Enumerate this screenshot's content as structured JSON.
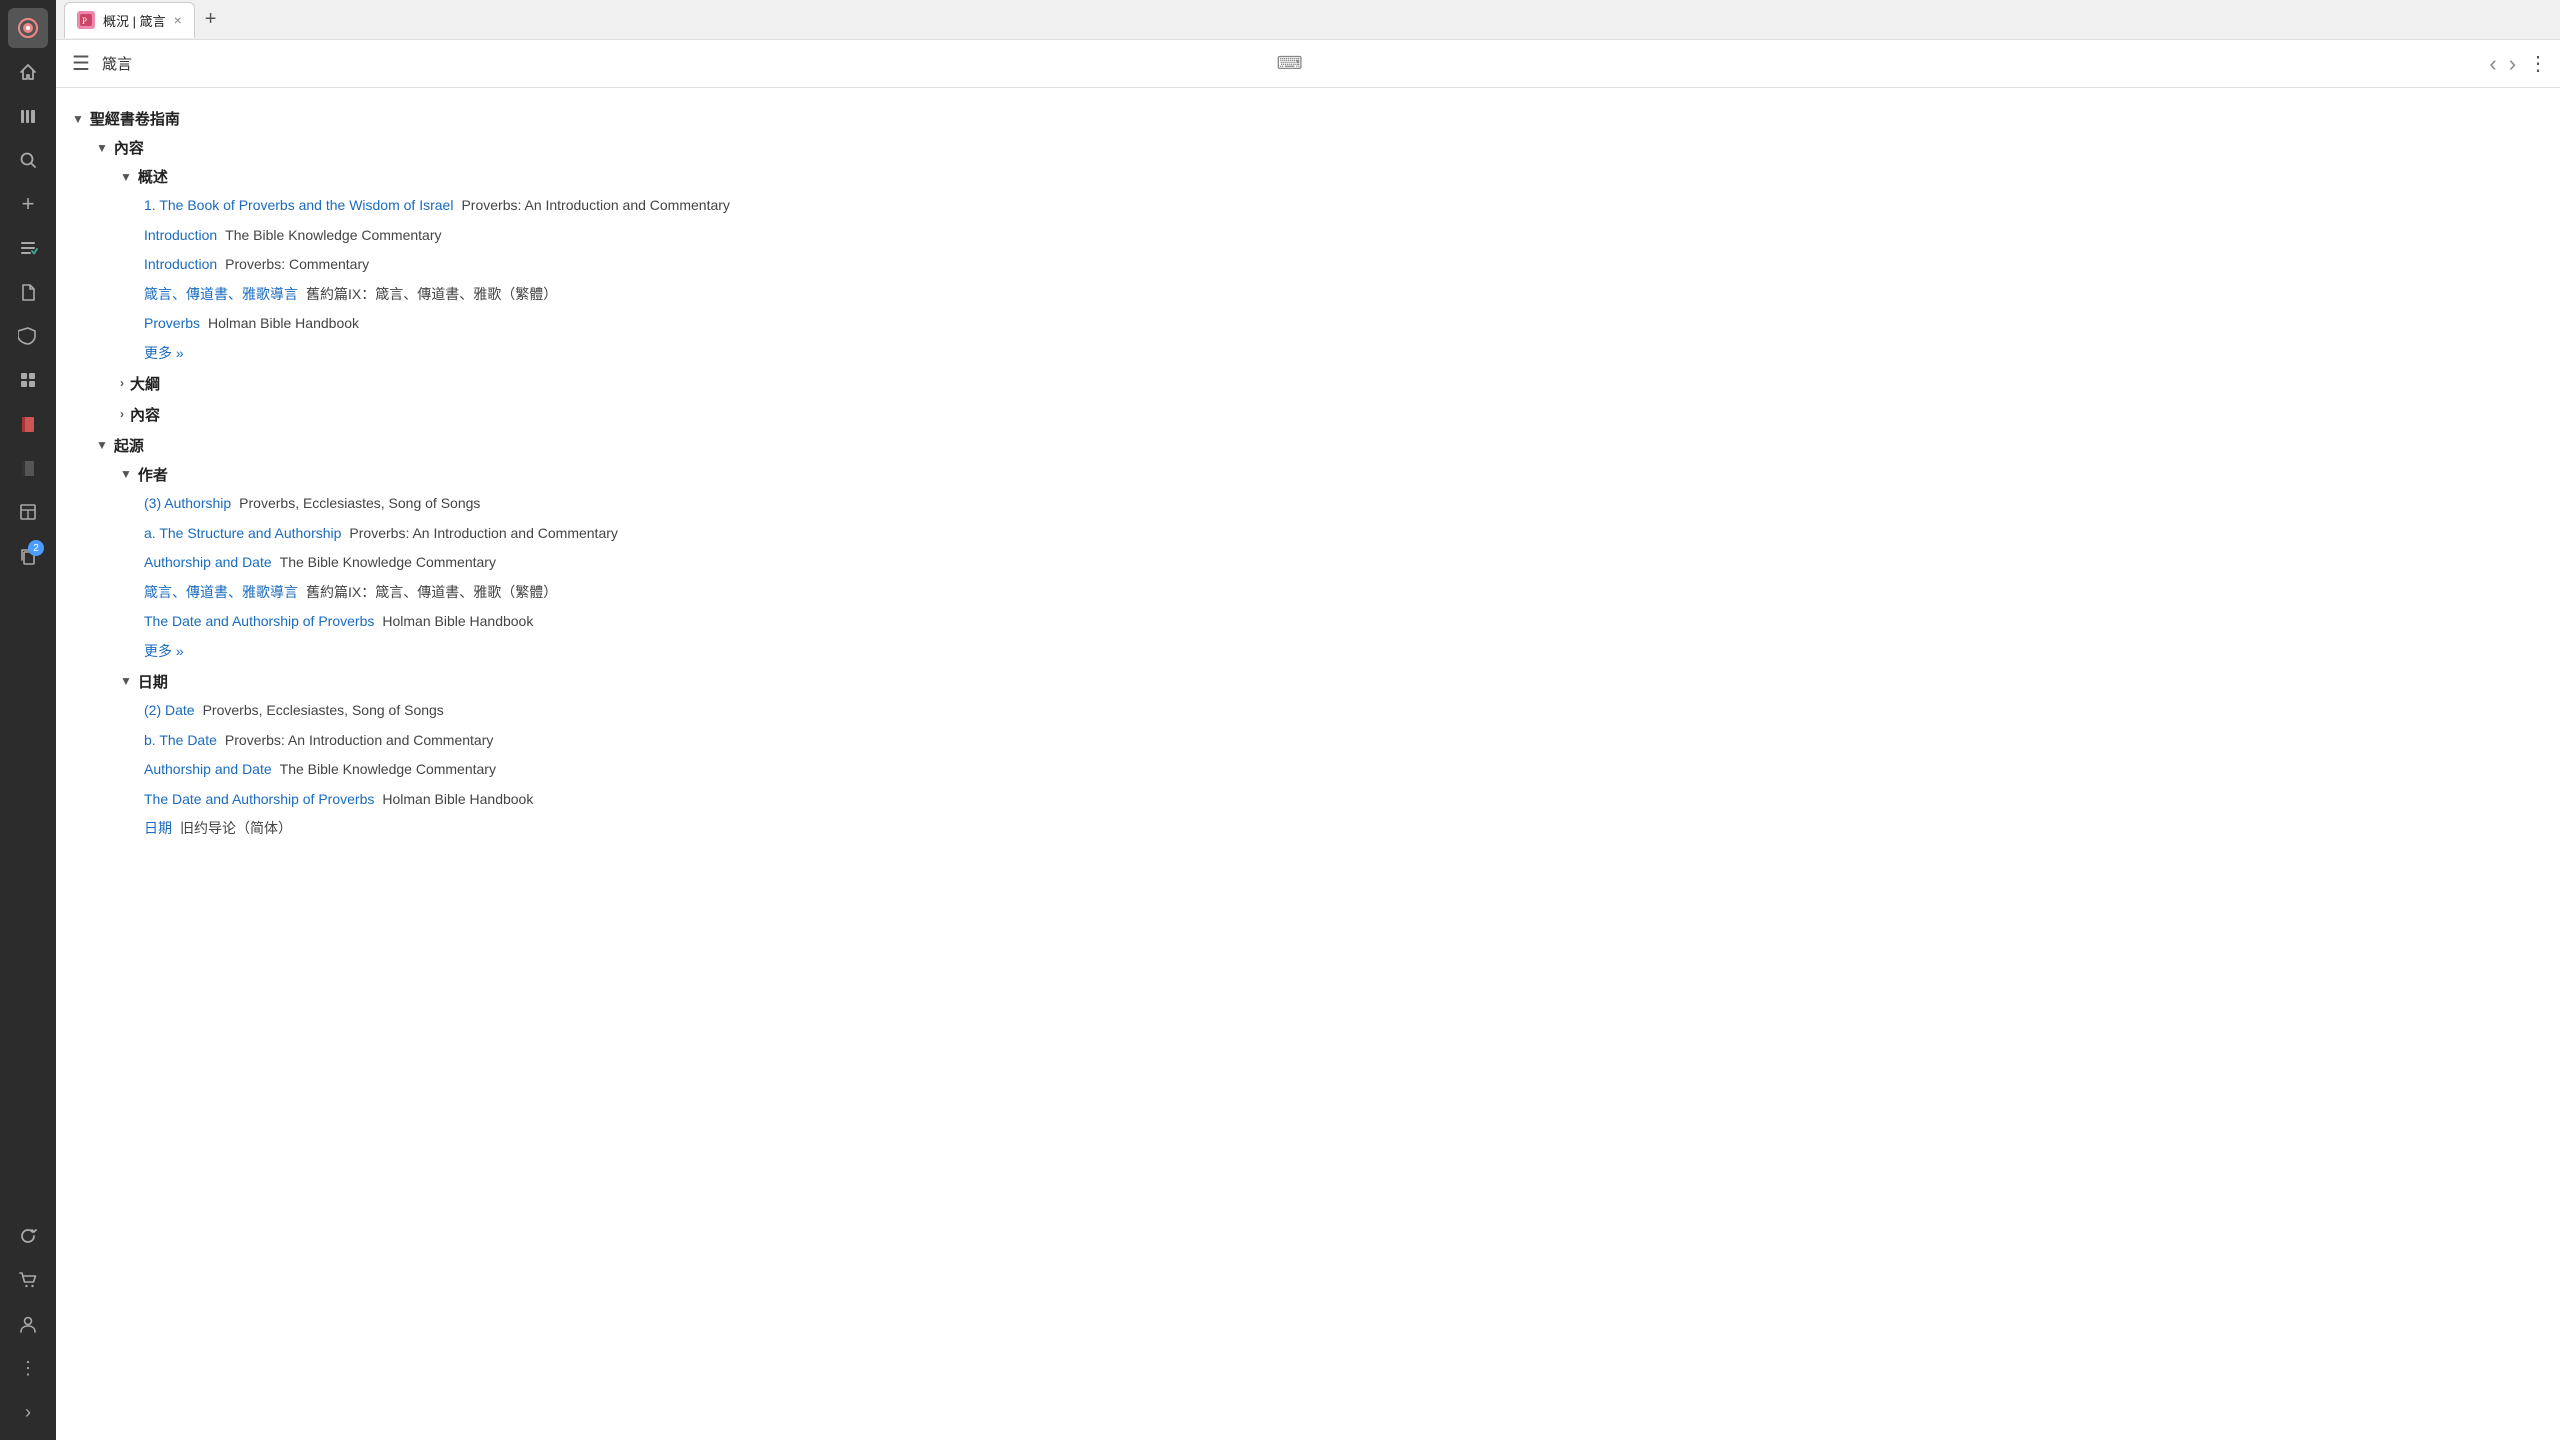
{
  "app_icon": "◎",
  "tab": {
    "label": "概況 | 箴言",
    "close": "×"
  },
  "tab_add": "+",
  "toolbar": {
    "menu_icon": "☰",
    "title": "箴言",
    "kbd_icon": "⌨",
    "nav_back": "‹",
    "nav_forward": "›",
    "more": "⋮"
  },
  "tree": {
    "root_label": "聖經書卷指南",
    "sections": [
      {
        "label": "內容",
        "expanded": true,
        "subsections": [
          {
            "label": "概述",
            "expanded": true,
            "items": [
              {
                "link": "1. The Book of Proverbs and the Wisdom of Israel",
                "desc": "Proverbs: An Introduction and Commentary"
              },
              {
                "link": "Introduction",
                "desc": "The Bible Knowledge Commentary"
              },
              {
                "link": "Introduction",
                "desc": "Proverbs: Commentary"
              },
              {
                "link": "箴言、傳道書、雅歌導言",
                "desc": "舊約篇IX：箴言、傳道書、雅歌（繁體）"
              },
              {
                "link": "Proverbs",
                "desc": "Holman Bible Handbook"
              }
            ],
            "more": "更多 »"
          },
          {
            "label": "大綱",
            "expanded": false,
            "items": [],
            "more": null
          },
          {
            "label": "內容",
            "expanded": false,
            "items": [],
            "more": null
          }
        ]
      },
      {
        "label": "起源",
        "expanded": true,
        "subsections": [
          {
            "label": "作者",
            "expanded": true,
            "items": [
              {
                "link": "(3) Authorship",
                "desc": "Proverbs, Ecclesiastes, Song of Songs"
              },
              {
                "link": "a. The Structure and Authorship",
                "desc": "Proverbs: An Introduction and Commentary"
              },
              {
                "link": "Authorship and Date",
                "desc": "The Bible Knowledge Commentary"
              },
              {
                "link": "箴言、傳道書、雅歌導言",
                "desc": "舊約篇IX：箴言、傳道書、雅歌（繁體）"
              },
              {
                "link": "The Date and Authorship of Proverbs",
                "desc": "Holman Bible Handbook"
              }
            ],
            "more": "更多 »"
          },
          {
            "label": "日期",
            "expanded": true,
            "items": [
              {
                "link": "(2) Date",
                "desc": "Proverbs, Ecclesiastes, Song of Songs"
              },
              {
                "link": "b. The Date",
                "desc": "Proverbs: An Introduction and Commentary"
              },
              {
                "link": "Authorship and Date",
                "desc": "The Bible Knowledge Commentary"
              },
              {
                "link": "The Date and Authorship of Proverbs",
                "desc": "Holman Bible Handbook"
              },
              {
                "link": "日期",
                "desc": "旧约导论（简体）"
              }
            ],
            "more": null
          }
        ]
      }
    ]
  },
  "sidebar": {
    "icons": [
      {
        "name": "app-logo",
        "glyph": "◎",
        "active": true
      },
      {
        "name": "home",
        "glyph": "⌂"
      },
      {
        "name": "library",
        "glyph": "📚"
      },
      {
        "name": "search",
        "glyph": "🔍"
      },
      {
        "name": "add-resource",
        "glyph": "+"
      },
      {
        "name": "tasks",
        "glyph": "✓"
      },
      {
        "name": "documents",
        "glyph": "📄"
      },
      {
        "name": "shield",
        "glyph": "🛡"
      },
      {
        "name": "grid",
        "glyph": "⊞"
      },
      {
        "name": "book-red",
        "glyph": "📕"
      },
      {
        "name": "book-dark",
        "glyph": "📗"
      },
      {
        "name": "layout",
        "glyph": "▦"
      },
      {
        "name": "copy",
        "glyph": "⧉"
      }
    ],
    "badge_count": "2",
    "bottom_icons": [
      {
        "name": "sync",
        "glyph": "↻"
      },
      {
        "name": "cart",
        "glyph": "🛒"
      },
      {
        "name": "user",
        "glyph": "👤"
      },
      {
        "name": "more-vert",
        "glyph": "⋮"
      },
      {
        "name": "expand",
        "glyph": "›"
      }
    ]
  }
}
